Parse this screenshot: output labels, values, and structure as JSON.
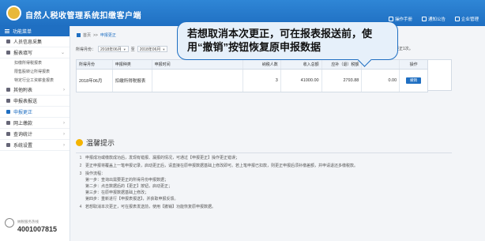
{
  "header": {
    "title": "自然人税收管理系统扣缴客户端",
    "links": [
      "操作手册",
      "通知公告",
      "企业管理"
    ]
  },
  "sidebar": {
    "heading": "功能菜单",
    "items": [
      {
        "label": "人员信息采集",
        "active": false,
        "arrow": ""
      },
      {
        "label": "报表填写",
        "active": false,
        "arrow": "⌄"
      }
    ],
    "subitems": [
      "扣缴所得税报表",
      "限售股转让所得报表",
      "特定行业工资薪金报表"
    ],
    "items_after": [
      {
        "label": "其他附表",
        "active": false,
        "arrow": "›"
      },
      {
        "label": "申报表报送",
        "active": false,
        "arrow": ""
      },
      {
        "label": "申报更正",
        "active": true,
        "arrow": ""
      },
      {
        "label": "网上缴款",
        "active": false,
        "arrow": "›"
      },
      {
        "label": "查询统计",
        "active": false,
        "arrow": "›"
      },
      {
        "label": "系统设置",
        "active": false,
        "arrow": "›"
      }
    ],
    "phone_label": "纳税服务热线",
    "phone_number": "4001007815"
  },
  "tabbar": {
    "home": "首页",
    "sep": ">>",
    "current": "申报更正"
  },
  "filter": {
    "label_from": "所得月份：",
    "from_value": "2018年06月",
    "to_label": "至",
    "to_value": "2018年06月",
    "right_note": "份每月可更正1次。"
  },
  "table": {
    "headers": [
      "所得月份",
      "申报种类",
      "申报时间",
      "纳税人数",
      "收入总额",
      "应补（退）税额",
      "",
      "操作"
    ],
    "rows": [
      {
        "month": "2018年06月",
        "type": "扣缴所得税报表",
        "time": "",
        "count": "3",
        "income": "41000.00",
        "tax": "2793.88",
        "extra": "0.00",
        "action": "撤销"
      }
    ]
  },
  "callout": {
    "text": "若想取消本次更正，可在报表报送前，使用“撤销”按钮恢复原申报数据"
  },
  "tips": {
    "title": "温馨提示",
    "rows": [
      {
        "num": "1",
        "text": "申报成功或缴款成功后，发现有错报、漏报的情况，可通过【申报更正】操作更正错误；"
      },
      {
        "num": "2",
        "text": "更正申报将覆盖上一笔申报记录，启动更正后，请直接在原申报数据基础上修改即可。若上笔申报已扣款，则更正申报后须补缴差额，并申请退还多缴税款。"
      },
      {
        "num": "3",
        "text": "操作流程："
      }
    ],
    "steps": [
      "第一步：查询出需要更正的所得月份申报数据；",
      "第二步：点击数据后的【更正】按钮，启动更正；",
      "第三步：在原申报数据基础上修改；",
      "第四步：重新进行【申报表报送】，并获取申报反馈。"
    ],
    "last": {
      "num": "4",
      "text": "若想取消本次更正，可在报表发送前，使用【撤销】功能恢复原申报数据。"
    }
  },
  "colors": {
    "header_blue": "#1f6fc2",
    "accent": "#1f6fc2",
    "bulb": "#f4b400"
  }
}
